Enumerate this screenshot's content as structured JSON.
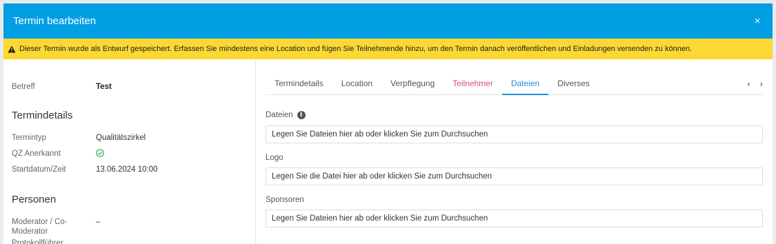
{
  "header": {
    "title": "Termin bearbeiten",
    "close_label": "×"
  },
  "warning": {
    "text": "Dieser Termin wurde als Entwurf gespeichert. Erfassen Sie mindestens eine Location und fügen Sie Teilnehmende hinzu, um den Termin danach veröffentlichen und Einladungen versenden zu können."
  },
  "left": {
    "betreff_label": "Betreff",
    "betreff_value": "Test",
    "termindetails_title": "Termindetails",
    "termintyp_label": "Termintyp",
    "termintyp_value": "Qualitätszirkel",
    "qz_label": "QZ Anerkannt",
    "start_label": "Startdatum/Zeit",
    "start_value": "13.06.2024 10:00",
    "personen_title": "Personen",
    "moderator_label_1": "Moderator / Co-",
    "moderator_label_2": "Moderator",
    "moderator_value": "–",
    "protokoll_label": "Protokollführer",
    "protokoll_value": "–"
  },
  "tabs": [
    {
      "label": "Termindetails"
    },
    {
      "label": "Location"
    },
    {
      "label": "Verpflegung"
    },
    {
      "label": "Teilnehmer"
    },
    {
      "label": "Dateien"
    },
    {
      "label": "Diverses"
    }
  ],
  "tab_nav": {
    "prev": "‹",
    "next": "›"
  },
  "fields": {
    "dateien_label": "Dateien",
    "dateien_drop": "Legen Sie Dateien hier ab oder klicken Sie zum Durchsuchen",
    "logo_label": "Logo",
    "logo_drop": "Legen Sie die Datei hier ab oder klicken Sie zum Durchsuchen",
    "sponsoren_label": "Sponsoren",
    "sponsoren_drop": "Legen Sie Dateien hier ab oder klicken Sie zum Durchsuchen"
  },
  "colors": {
    "header": "#009ee3",
    "warning": "#fdd834",
    "active_tab": "#1f8fd6",
    "warn_tab": "#e0487a",
    "check": "#2eaa4f"
  }
}
